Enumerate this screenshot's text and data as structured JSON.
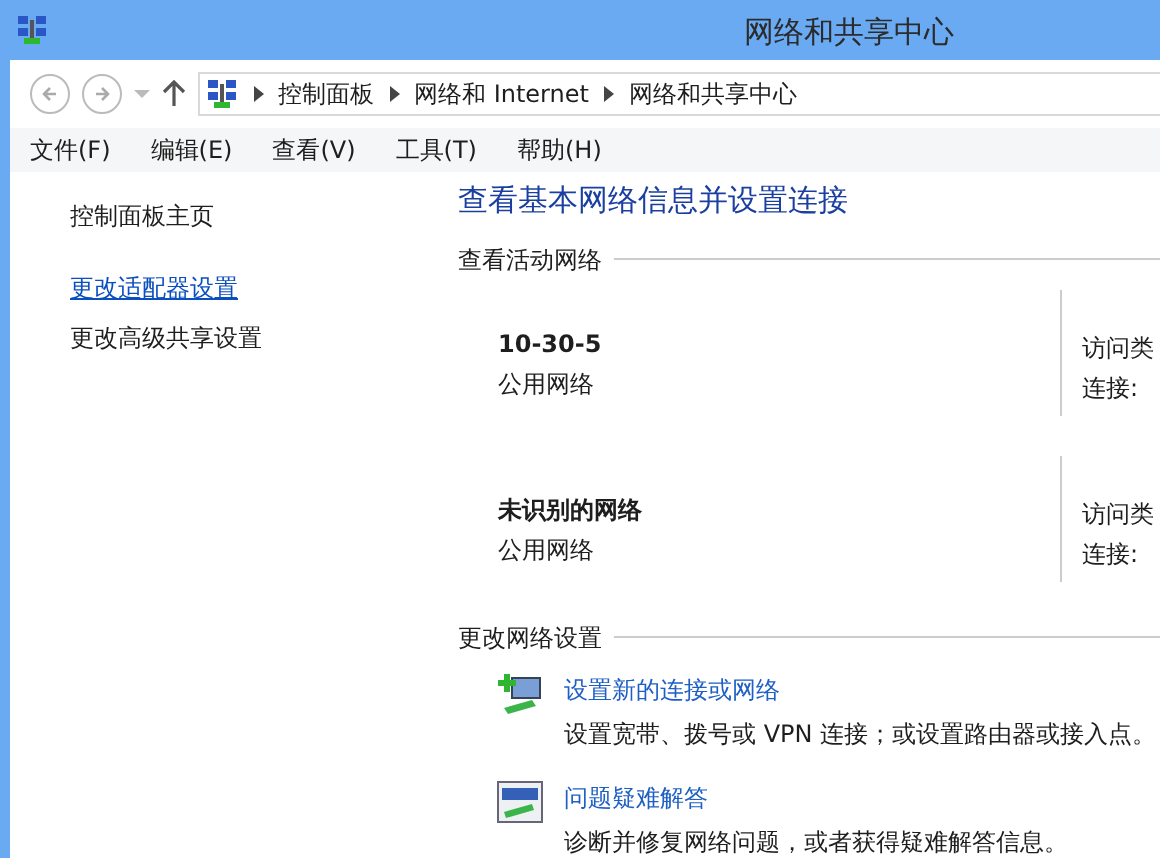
{
  "window": {
    "title": "网络和共享中心"
  },
  "address_bar": {
    "crumbs": [
      "控制面板",
      "网络和 Internet",
      "网络和共享中心"
    ]
  },
  "menu": [
    "文件(F)",
    "编辑(E)",
    "查看(V)",
    "工具(T)",
    "帮助(H)"
  ],
  "sidebar": {
    "items": [
      {
        "label": "控制面板主页",
        "kind": "text"
      },
      {
        "label": "更改适配器设置",
        "kind": "link"
      },
      {
        "label": "更改高级共享设置",
        "kind": "text"
      }
    ]
  },
  "main": {
    "heading": "查看基本网络信息并设置连接",
    "active_networks": {
      "title": "查看活动网络",
      "networks": [
        {
          "name": "10-30-5",
          "category": "公用网络",
          "labels": [
            "访问类",
            "连接:"
          ]
        },
        {
          "name": "未识别的网络",
          "category": "公用网络",
          "labels": [
            "访问类",
            "连接:"
          ]
        }
      ]
    },
    "change_settings": {
      "title": "更改网络设置",
      "items": [
        {
          "kind": "new-connection",
          "link": "设置新的连接或网络",
          "description": "设置宽带、拨号或 VPN 连接；或设置路由器或接入点。"
        },
        {
          "kind": "troubleshoot",
          "link": "问题疑难解答",
          "description": "诊断并修复网络问题，或者获得疑难解答信息。"
        }
      ]
    }
  }
}
